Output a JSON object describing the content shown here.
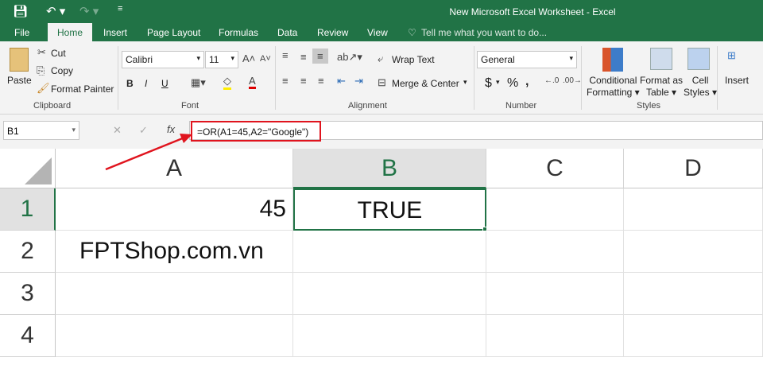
{
  "window": {
    "title": "New Microsoft Excel Worksheet - Excel"
  },
  "tabs": [
    "File",
    "Home",
    "Insert",
    "Page Layout",
    "Formulas",
    "Data",
    "Review",
    "View"
  ],
  "tell_me": "Tell me what you want to do...",
  "clipboard": {
    "paste": "Paste",
    "cut": "Cut",
    "copy": "Copy",
    "format_painter": "Format Painter",
    "label": "Clipboard"
  },
  "font": {
    "name": "Calibri",
    "size": "11",
    "bold": "B",
    "italic": "I",
    "underline": "U",
    "label": "Font"
  },
  "alignment": {
    "wrap": "Wrap Text",
    "merge": "Merge & Center",
    "label": "Alignment"
  },
  "number": {
    "format": "General",
    "currency": "$",
    "percent": "%",
    "comma": ",",
    "label": "Number"
  },
  "styles": {
    "conditional": [
      "Conditional",
      "Formatting ▾"
    ],
    "table": [
      "Format as",
      "Table ▾"
    ],
    "cell": [
      "Cell",
      "Styles ▾"
    ],
    "label": "Styles"
  },
  "cells_group": {
    "insert": "Insert"
  },
  "formula_bar": {
    "name_box": "B1",
    "formula": "=OR(A1=45,A2=\"Google\")",
    "fx": "fx"
  },
  "columns": [
    "A",
    "B",
    "C",
    "D"
  ],
  "rows": [
    "1",
    "2",
    "3",
    "4"
  ],
  "cells": {
    "A1": "45",
    "B1": "TRUE",
    "A2": "FPTShop.com.vn"
  },
  "colors": {
    "brand": "#217346",
    "highlight": "#e0141e"
  }
}
